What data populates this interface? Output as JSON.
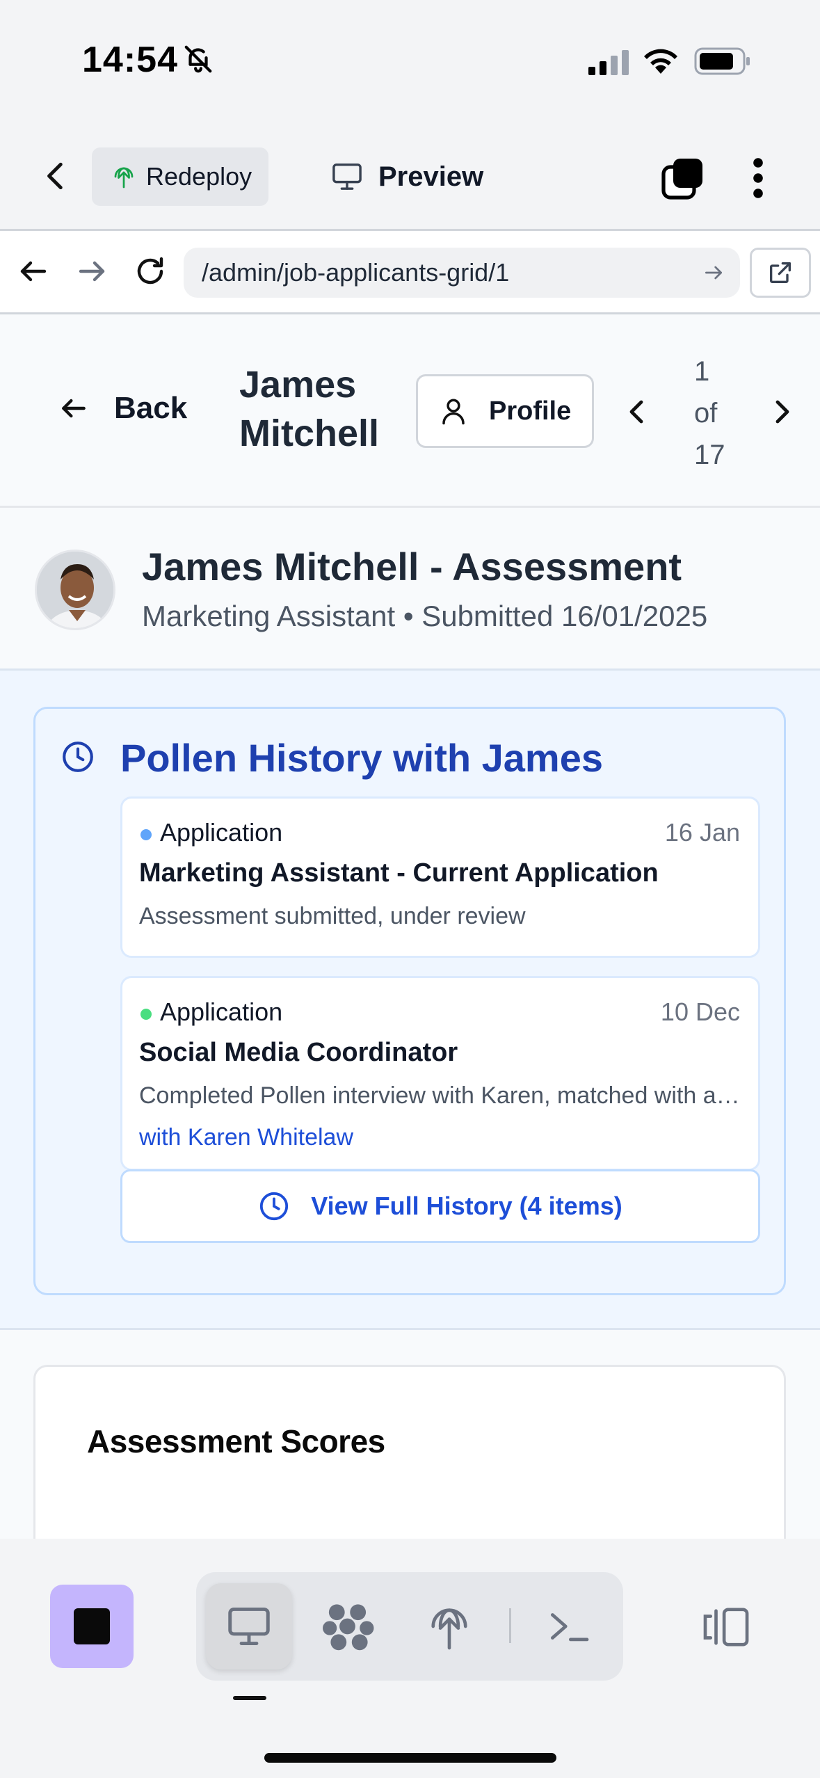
{
  "status_bar": {
    "time": "14:54"
  },
  "toolbar": {
    "redeploy_label": "Redeploy",
    "preview_label": "Preview"
  },
  "url_bar": {
    "url": "/admin/job-applicants-grid/1"
  },
  "header": {
    "back_label": "Back",
    "name_first": "James",
    "name_last": "Mitchell",
    "profile_label": "Profile",
    "pager": {
      "current": "1",
      "of": "of",
      "total": "17"
    }
  },
  "candidate": {
    "title": "James Mitchell - Assessment",
    "subtitle": "Marketing Assistant • Submitted 16/01/2025"
  },
  "history": {
    "title": "Pollen History with James",
    "items": [
      {
        "kind": "Application",
        "date": "16 Jan",
        "role": "Marketing Assistant - Current Application",
        "description": "Assessment submitted, under review",
        "dot_color": "#60a5fa"
      },
      {
        "kind": "Application",
        "date": "10 Dec",
        "role": "Social Media Coordinator",
        "description": "Completed Pollen interview with Karen, matched with a similar role",
        "with": "with Karen Whitelaw",
        "dot_color": "#4ade80"
      }
    ],
    "view_full_label": "View Full History (4 items)"
  },
  "scores": {
    "title": "Assessment Scores"
  },
  "colors": {
    "accent_blue": "#1d4ed8",
    "history_bg": "#eff6ff",
    "stop_button": "#c4b5fd"
  },
  "dock": {
    "icons": [
      "stop-icon",
      "desktop-icon",
      "apps-icon",
      "deploy-icon",
      "terminal-icon",
      "panel-icon"
    ]
  }
}
